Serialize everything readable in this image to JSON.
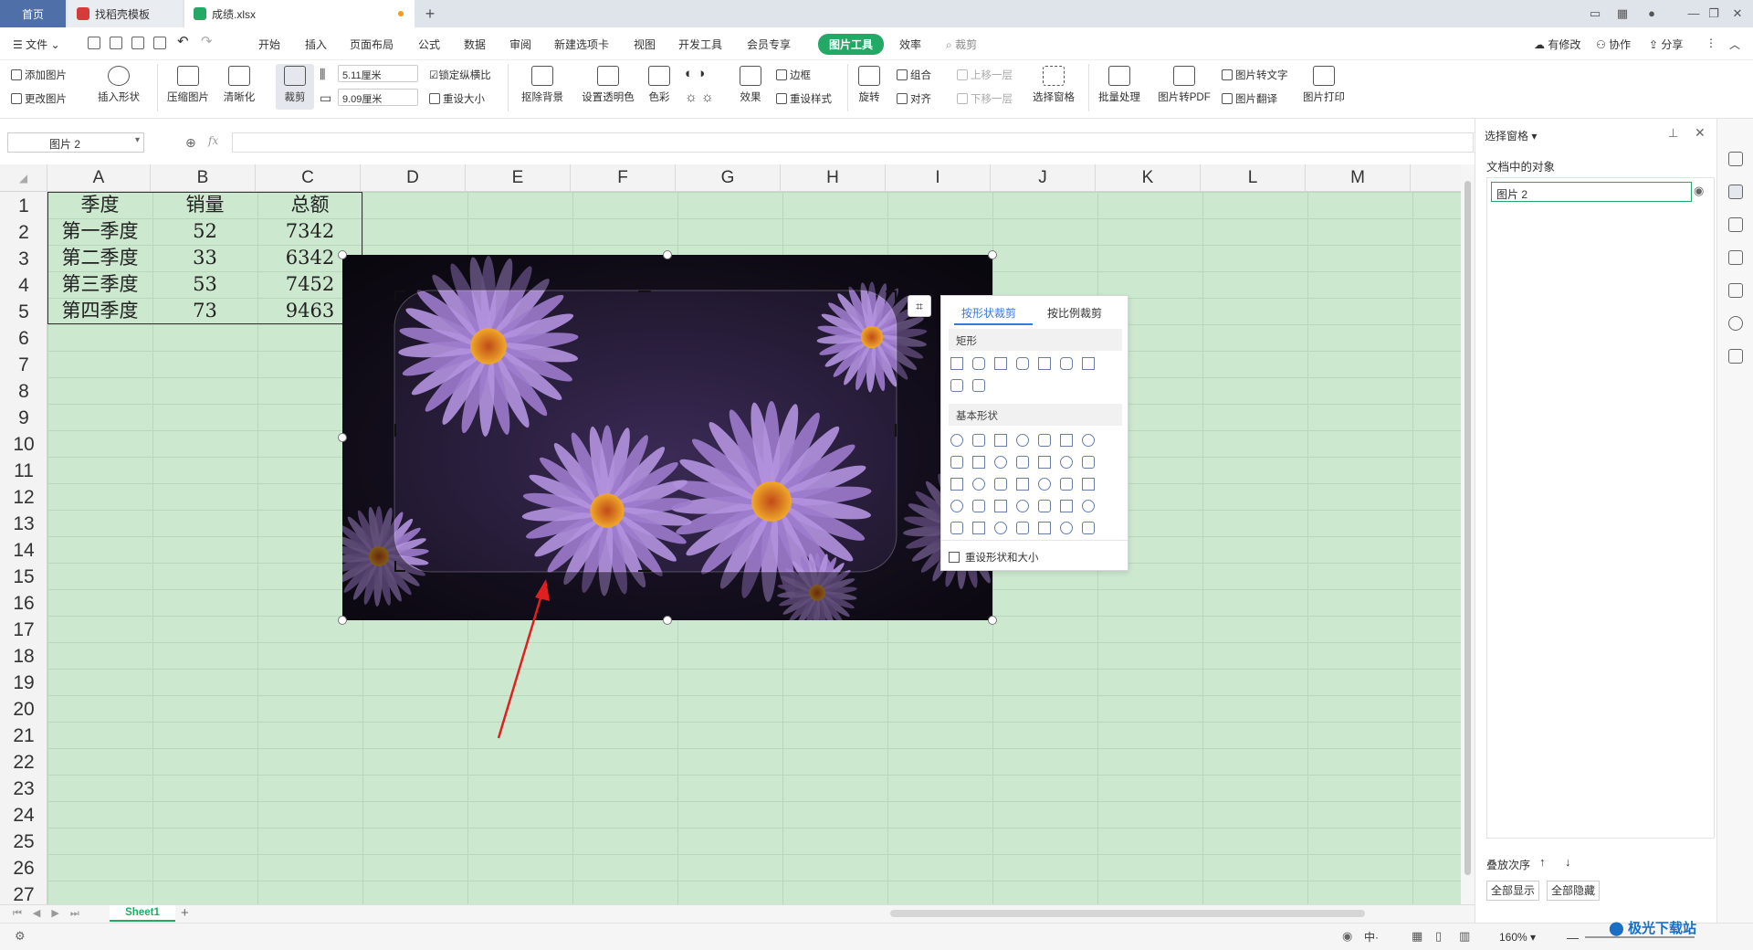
{
  "tabs": [
    {
      "label": "首页"
    },
    {
      "label": "找稻壳模板"
    },
    {
      "label": "成绩.xlsx"
    }
  ],
  "menu": {
    "file": "文件",
    "items": [
      "开始",
      "插入",
      "页面布局",
      "公式",
      "数据",
      "审阅",
      "新建选项卡",
      "视图",
      "开发工具",
      "会员专享",
      "图片工具",
      "效率"
    ],
    "active": "图片工具",
    "search": "裁剪",
    "right": [
      "有修改",
      "协作",
      "分享"
    ]
  },
  "ribbon": {
    "add_picture": "添加图片",
    "change_picture": "更改图片",
    "insert_shape": "插入形状",
    "compress": "压缩图片",
    "sharpen": "清晰化",
    "crop": "裁剪",
    "width": "5.11厘米",
    "height": "9.09厘米",
    "lock_ratio": "锁定纵横比",
    "reset_size": "重设大小",
    "remove_bg": "抠除背景",
    "set_transparent": "设置透明色",
    "color": "色彩",
    "effect": "效果",
    "border": "边框",
    "reset_style": "重设样式",
    "rotate": "旋转",
    "group": "组合",
    "align": "对齐",
    "bring_forward": "上移一层",
    "send_backward": "下移一层",
    "selection_pane": "选择窗格",
    "batch": "批量处理",
    "to_pdf": "图片转PDF",
    "to_text": "图片转文字",
    "translate": "图片翻译",
    "print": "图片打印"
  },
  "namebox": "图片 2",
  "fx": "fx",
  "columns": [
    "A",
    "B",
    "C",
    "D",
    "E",
    "F",
    "G",
    "H",
    "I",
    "J",
    "K",
    "L",
    "M"
  ],
  "rows": [
    "1",
    "2",
    "3",
    "4",
    "5",
    "6",
    "7",
    "8",
    "9",
    "10",
    "11",
    "12",
    "13",
    "14",
    "15",
    "16",
    "17",
    "18",
    "19",
    "20",
    "21",
    "22",
    "23",
    "24",
    "25",
    "26",
    "27"
  ],
  "table": [
    [
      "季度",
      "销量",
      "总额"
    ],
    [
      "第一季度",
      "52",
      "7342"
    ],
    [
      "第二季度",
      "33",
      "6342"
    ],
    [
      "第三季度",
      "53",
      "7452"
    ],
    [
      "第四季度",
      "73",
      "9463"
    ]
  ],
  "crop_popup": {
    "tab_shape": "按形状裁剪",
    "tab_ratio": "按比例裁剪",
    "section_rect": "矩形",
    "section_basic": "基本形状",
    "reset": "重设形状和大小"
  },
  "selection_pane": {
    "title": "选择窗格",
    "objects_label": "文档中的对象",
    "object": "图片 2",
    "order_label": "叠放次序",
    "show_all": "全部显示",
    "hide_all": "全部隐藏"
  },
  "sheet": {
    "name": "Sheet1"
  },
  "status": {
    "zoom": "160%",
    "lang": "中"
  },
  "watermark": "极光下载站",
  "colors": {
    "accent": "#23a865",
    "grid_bg": "#cce8cf",
    "home_tab": "#4f6fa8"
  }
}
